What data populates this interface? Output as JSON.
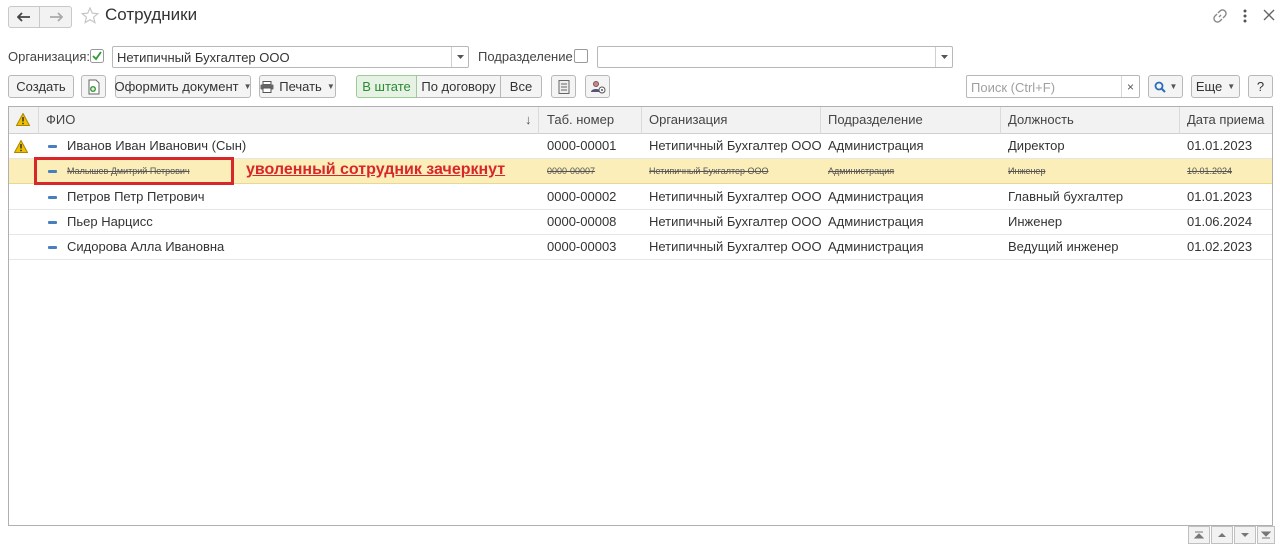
{
  "window": {
    "title": "Сотрудники",
    "icons": [
      "back-arrow-icon",
      "forward-arrow-icon",
      "star-icon",
      "link-icon",
      "more-icon",
      "close-icon"
    ]
  },
  "filters": {
    "org_label": "Организация:",
    "org_checked": true,
    "org_value": "Нетипичный Бухгалтер ООО",
    "subdiv_label": "Подразделение:",
    "subdiv_checked": false,
    "subdiv_value": ""
  },
  "toolbar": {
    "create": "Создать",
    "make_document": "Оформить документ",
    "print": "Печать",
    "segments": [
      "В штате",
      "По договору",
      "Все"
    ],
    "active_segment": "В штате",
    "search_placeholder": "Поиск (Ctrl+F)",
    "search_clear": "×",
    "more": "Еще",
    "help": "?"
  },
  "table": {
    "columns": [
      "ФИО",
      "Таб. номер",
      "Организация",
      "Подразделение",
      "Должность",
      "Дата приема"
    ],
    "sort_arrow": "↓",
    "rows": [
      {
        "warning": true,
        "name": "Иванов Иван Иванович (Сын)",
        "tab": "0000-00001",
        "org": "Нетипичный Бухгалтер ООО",
        "dept": "Администрация",
        "position": "Директор",
        "date": "01.01.2023",
        "dismissed": false
      },
      {
        "warning": false,
        "name": "Малышев Дмитрий Петрович",
        "tab": "0000-00007",
        "org": "Нетипичный Бухгалтер ООО",
        "dept": "Администрация",
        "position": "Инженер",
        "date": "10.01.2024",
        "dismissed": true
      },
      {
        "warning": false,
        "name": "Петров Петр Петрович",
        "tab": "0000-00002",
        "org": "Нетипичный Бухгалтер ООО",
        "dept": "Администрация",
        "position": "Главный бухгалтер",
        "date": "01.01.2023",
        "dismissed": false
      },
      {
        "warning": false,
        "name": "Пьер Нарцисс",
        "tab": "0000-00008",
        "org": "Нетипичный Бухгалтер ООО",
        "dept": "Администрация",
        "position": "Инженер",
        "date": "01.06.2024",
        "dismissed": false
      },
      {
        "warning": false,
        "name": "Сидорова Алла Ивановна",
        "tab": "0000-00003",
        "org": "Нетипичный Бухгалтер ООО",
        "dept": "Администрация",
        "position": "Ведущий инженер",
        "date": "01.02.2023",
        "dismissed": false
      }
    ]
  },
  "annotation": {
    "text": "уволенный сотрудник зачеркнут",
    "color": "#d8262a"
  },
  "colors": {
    "selected_row": "#fbeeb8",
    "active_segment": "#2d8a35",
    "row_marker": "#4a7fbf",
    "warning": "#e8b800"
  }
}
